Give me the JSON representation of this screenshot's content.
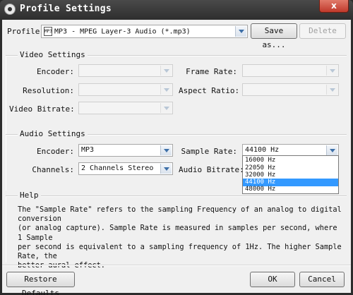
{
  "window": {
    "title": "Profile Settings",
    "close_label": "x"
  },
  "profile": {
    "label": "Profile:",
    "value": "MP3 - MPEG Layer-3 Audio (*.mp3)",
    "badge": "MP3",
    "save_as": "Save as...",
    "delete": "Delete"
  },
  "video": {
    "title": "Video Settings",
    "encoder_label": "Encoder:",
    "frame_rate_label": "Frame Rate:",
    "resolution_label": "Resolution:",
    "aspect_ratio_label": "Aspect Ratio:",
    "bitrate_label": "Video Bitrate:"
  },
  "audio": {
    "title": "Audio Settings",
    "encoder_label": "Encoder:",
    "encoder_value": "MP3",
    "sample_rate_label": "Sample Rate:",
    "sample_rate_value": "44100 Hz",
    "channels_label": "Channels:",
    "channels_value": "2 Channels Stereo",
    "bitrate_label": "Audio Bitrate:",
    "sample_rate_options": [
      "16000 Hz",
      "22050 Hz",
      "32000 Hz",
      "44100 Hz",
      "48000 Hz"
    ],
    "selected_option": "44100 Hz"
  },
  "help": {
    "title": "Help",
    "lines": [
      "The \"Sample Rate\" refers to the sampling Frequency of an analog to digital conversion",
      "(or analog capture). Sample Rate is measured in samples per second, where 1 Sample",
      "per second is equivalent to a sampling frequency of 1Hz. The higher Sample Rate, the",
      "better aural effect."
    ]
  },
  "footer": {
    "restore_defaults": "Restore Defaults",
    "ok": "OK",
    "cancel": "Cancel"
  },
  "colors": {
    "accent": "#3399ff",
    "close": "#c0392b",
    "titlebar": "#3a3a3a"
  }
}
